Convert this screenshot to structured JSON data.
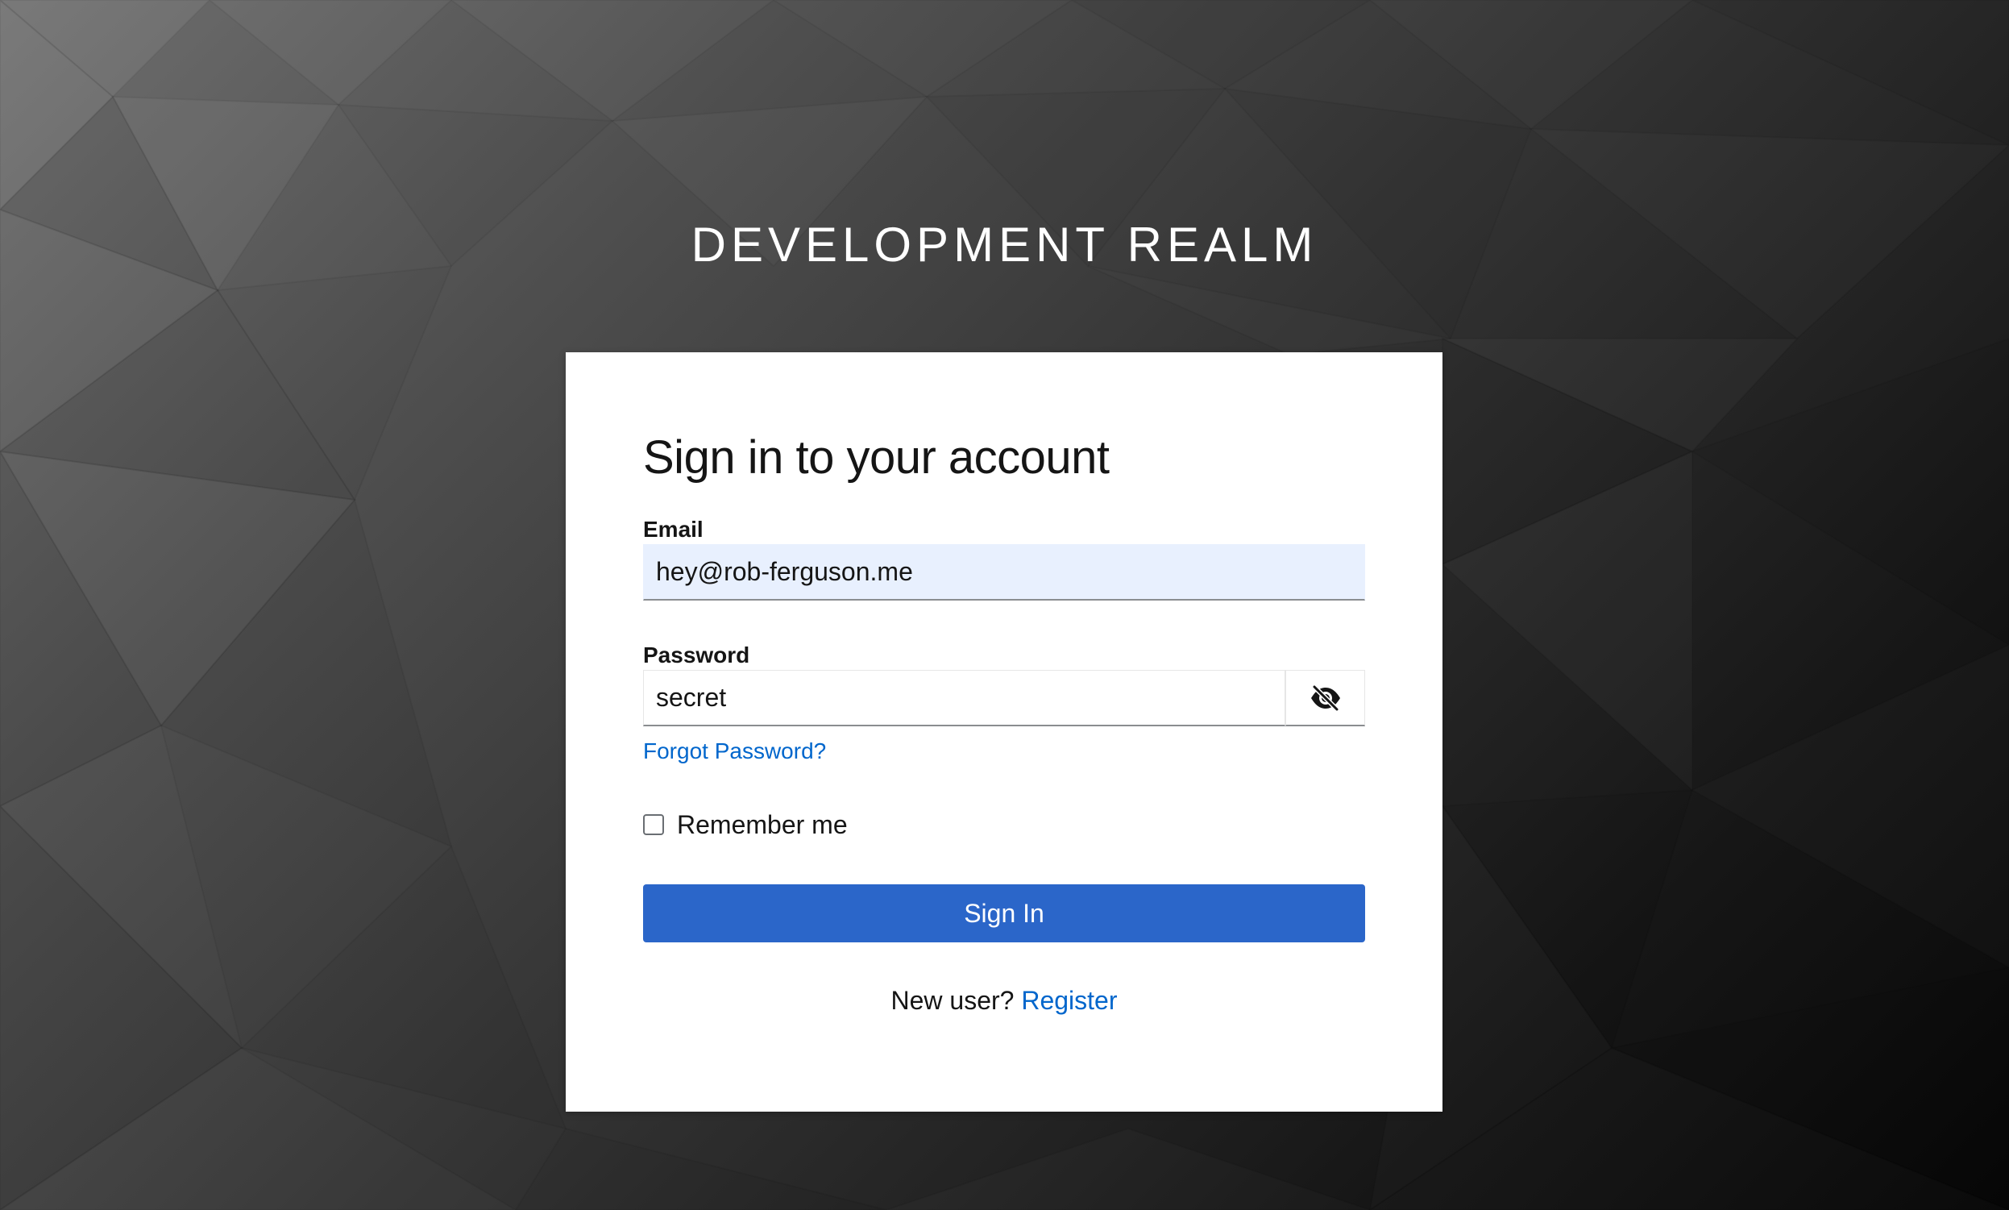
{
  "realm": {
    "title": "DEVELOPMENT REALM"
  },
  "login": {
    "heading": "Sign in to your account",
    "email_label": "Email",
    "email_value": "hey@rob-ferguson.me",
    "password_label": "Password",
    "password_value": "secret",
    "toggle_icon": "eye-slash-icon",
    "forgot_password": "Forgot Password?",
    "remember_me": "Remember me",
    "remember_checked": false,
    "sign_in": "Sign In",
    "new_user_text": "New user?",
    "register_link": "Register"
  },
  "colors": {
    "primary": "#2b66c9",
    "link": "#0066cc",
    "autofill_bg": "#e8f0fe"
  }
}
